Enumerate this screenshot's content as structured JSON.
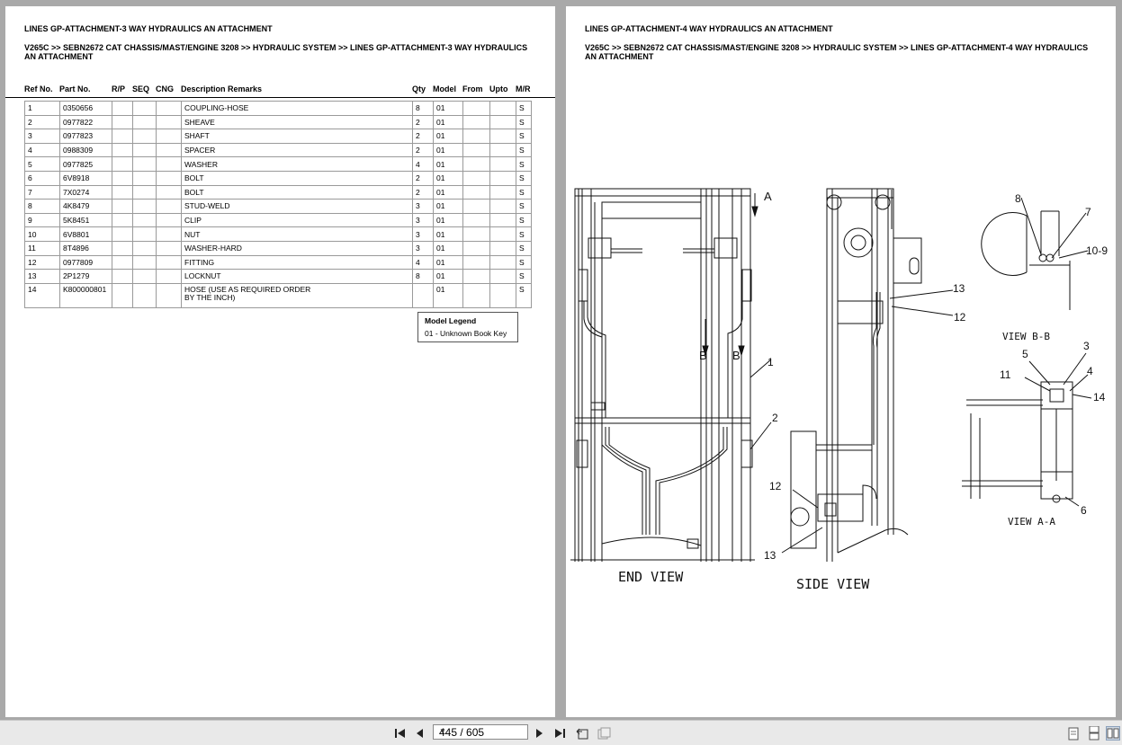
{
  "left_page": {
    "title": "LINES GP-ATTACHMENT-3 WAY HYDRAULICS AN ATTACHMENT",
    "breadcrumb": "V265C >> SEBN2672 CAT CHASSIS/MAST/ENGINE 3208 >> HYDRAULIC SYSTEM >> LINES GP-ATTACHMENT-3 WAY HYDRAULICS AN ATTACHMENT",
    "columns": {
      "ref": "Ref No.",
      "part": "Part No.",
      "rp": "R/P",
      "seq": "SEQ",
      "cng": "CNG",
      "desc": "Description Remarks",
      "qty": "Qty",
      "model": "Model",
      "from": "From",
      "upto": "Upto",
      "mr": "M/R"
    },
    "rows": [
      {
        "ref": "1",
        "part": "0350656",
        "desc": "COUPLING-HOSE",
        "qty": "8",
        "model": "01",
        "mr": "S"
      },
      {
        "ref": "2",
        "part": "0977822",
        "desc": "SHEAVE",
        "qty": "2",
        "model": "01",
        "mr": "S"
      },
      {
        "ref": "3",
        "part": "0977823",
        "desc": "SHAFT",
        "qty": "2",
        "model": "01",
        "mr": "S"
      },
      {
        "ref": "4",
        "part": "0988309",
        "desc": "SPACER",
        "qty": "2",
        "model": "01",
        "mr": "S"
      },
      {
        "ref": "5",
        "part": "0977825",
        "desc": "WASHER",
        "qty": "4",
        "model": "01",
        "mr": "S"
      },
      {
        "ref": "6",
        "part": "6V8918",
        "desc": "BOLT",
        "qty": "2",
        "model": "01",
        "mr": "S"
      },
      {
        "ref": "7",
        "part": "7X0274",
        "desc": "BOLT",
        "qty": "2",
        "model": "01",
        "mr": "S"
      },
      {
        "ref": "8",
        "part": "4K8479",
        "desc": "STUD-WELD",
        "qty": "3",
        "model": "01",
        "mr": "S"
      },
      {
        "ref": "9",
        "part": "5K8451",
        "desc": "CLIP",
        "qty": "3",
        "model": "01",
        "mr": "S"
      },
      {
        "ref": "10",
        "part": "6V8801",
        "desc": "NUT",
        "qty": "3",
        "model": "01",
        "mr": "S"
      },
      {
        "ref": "11",
        "part": "8T4896",
        "desc": "WASHER-HARD",
        "qty": "3",
        "model": "01",
        "mr": "S"
      },
      {
        "ref": "12",
        "part": "0977809",
        "desc": "FITTING",
        "qty": "4",
        "model": "01",
        "mr": "S"
      },
      {
        "ref": "13",
        "part": "2P1279",
        "desc": "LOCKNUT",
        "qty": "8",
        "model": "01",
        "mr": "S"
      },
      {
        "ref": "14",
        "part": "K800000801",
        "desc": "HOSE (USE AS REQUIRED ORDER",
        "desc2": "BY THE INCH)",
        "qty": "",
        "model": "01",
        "mr": "S"
      }
    ],
    "legend": {
      "title": "Model Legend",
      "item": "01 - Unknown Book Key"
    }
  },
  "right_page": {
    "title": "LINES GP-ATTACHMENT-4 WAY HYDRAULICS AN ATTACHMENT",
    "breadcrumb": "V265C >> SEBN2672 CAT CHASSIS/MAST/ENGINE 3208 >> HYDRAULIC SYSTEM >> LINES GP-ATTACHMENT-4 WAY HYDRAULICS AN ATTACHMENT",
    "drawing_labels": {
      "end_view": "END VIEW",
      "side_view": "SIDE VIEW",
      "view_bb": "VIEW B-B",
      "view_aa": "VIEW A-A",
      "a": "A",
      "b": "B",
      "c1": "1",
      "c2": "2",
      "c3": "3",
      "c4": "4",
      "c5": "5",
      "c6": "6",
      "c7": "7",
      "c8": "8",
      "c109": "10-9",
      "c11": "11",
      "c12": "12",
      "c13": "13",
      "c14": "14"
    }
  },
  "toolbar": {
    "page_indicator": "445 / 605",
    "icons": [
      "first-page-icon",
      "prev-page-icon",
      "next-page-icon",
      "last-page-icon",
      "back-view-icon",
      "forward-view-icon",
      "single-page-icon",
      "continuous-page-icon",
      "two-page-icon"
    ]
  }
}
